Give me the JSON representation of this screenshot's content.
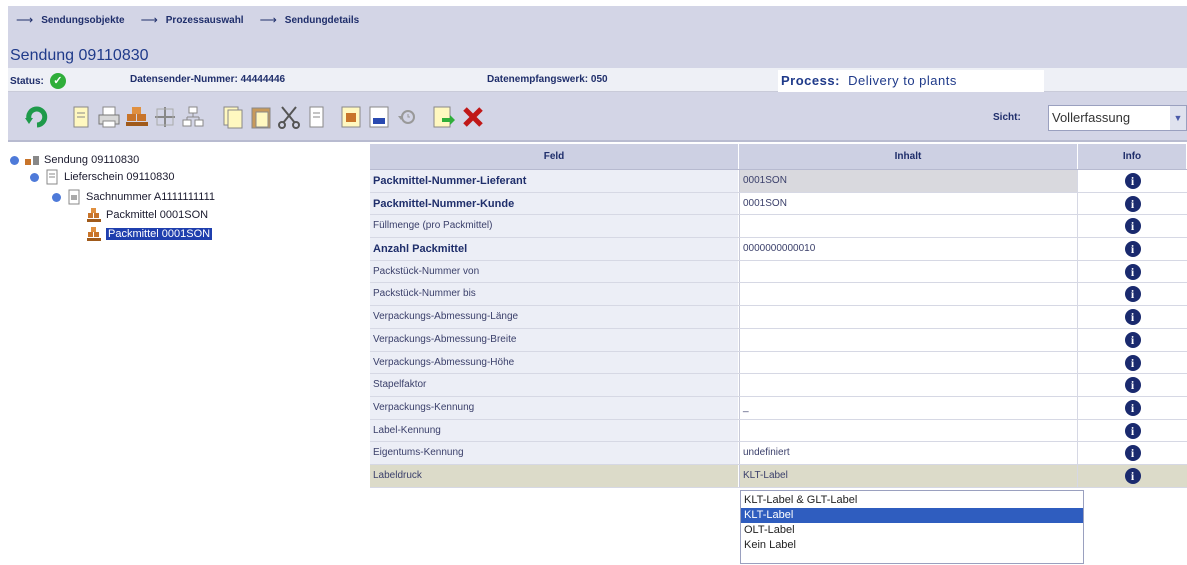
{
  "breadcrumbs": [
    "Sendungsobjekte",
    "Prozessauswahl",
    "Sendungdetails"
  ],
  "title": "Sendung 09110830",
  "status": {
    "label": "Status:",
    "sender": "Datensender-Nummer: 44444446",
    "empfangswerk": "Datenempfangswerk: 050",
    "process_label": "Process:",
    "process_value": "Delivery to plants"
  },
  "toolbar": {
    "icons": [
      "refresh-icon",
      "document-icon",
      "print-icon",
      "pallet-icon",
      "grid-icon",
      "tree-icon",
      "copy-icon",
      "paste-icon",
      "cut-icon",
      "duplicate-icon",
      "table-icon",
      "edi-icon",
      "history-icon",
      "export-icon",
      "delete-icon"
    ],
    "sicht_label": "Sicht:",
    "sicht_value": "Vollerfassung"
  },
  "tree": [
    {
      "label": "Sendung 09110830",
      "level": 0
    },
    {
      "label": "Lieferschein 09110830",
      "level": 1
    },
    {
      "label": "Sachnummer A1111111111",
      "level": 2
    },
    {
      "label": "Packmittel 0001SON",
      "level": 3
    },
    {
      "label": "Packmittel 0001SON",
      "level": 3,
      "selected": true
    }
  ],
  "table": {
    "headers": [
      "Feld",
      "Inhalt",
      "Info"
    ],
    "rows": [
      {
        "feld": "Packmittel-Nummer-Lieferant",
        "inhalt": "0001SON",
        "bold": true,
        "gray": true
      },
      {
        "feld": "Packmittel-Nummer-Kunde",
        "inhalt": "0001SON",
        "bold": true
      },
      {
        "feld": "Füllmenge (pro Packmittel)",
        "inhalt": ""
      },
      {
        "feld": "Anzahl Packmittel",
        "inhalt": "0000000000010",
        "bold": true
      },
      {
        "feld": "Packstück-Nummer von",
        "inhalt": ""
      },
      {
        "feld": "Packstück-Nummer bis",
        "inhalt": ""
      },
      {
        "feld": "Verpackungs-Abmessung-Länge",
        "inhalt": ""
      },
      {
        "feld": "Verpackungs-Abmessung-Breite",
        "inhalt": ""
      },
      {
        "feld": "Verpackungs-Abmessung-Höhe",
        "inhalt": ""
      },
      {
        "feld": "Stapelfaktor",
        "inhalt": ""
      },
      {
        "feld": "Verpackungs-Kennung",
        "inhalt": "_"
      },
      {
        "feld": "Label-Kennung",
        "inhalt": ""
      },
      {
        "feld": "Eigentums-Kennung",
        "inhalt": "undefiniert"
      },
      {
        "feld": "Labeldruck",
        "inhalt": "KLT-Label",
        "selected": true
      }
    ],
    "info_glyph": "i"
  },
  "dropdown_options": [
    {
      "label": "KLT-Label & GLT-Label"
    },
    {
      "label": "KLT-Label",
      "selected": true
    },
    {
      "label": "OLT-Label"
    },
    {
      "label": "Kein Label"
    }
  ]
}
